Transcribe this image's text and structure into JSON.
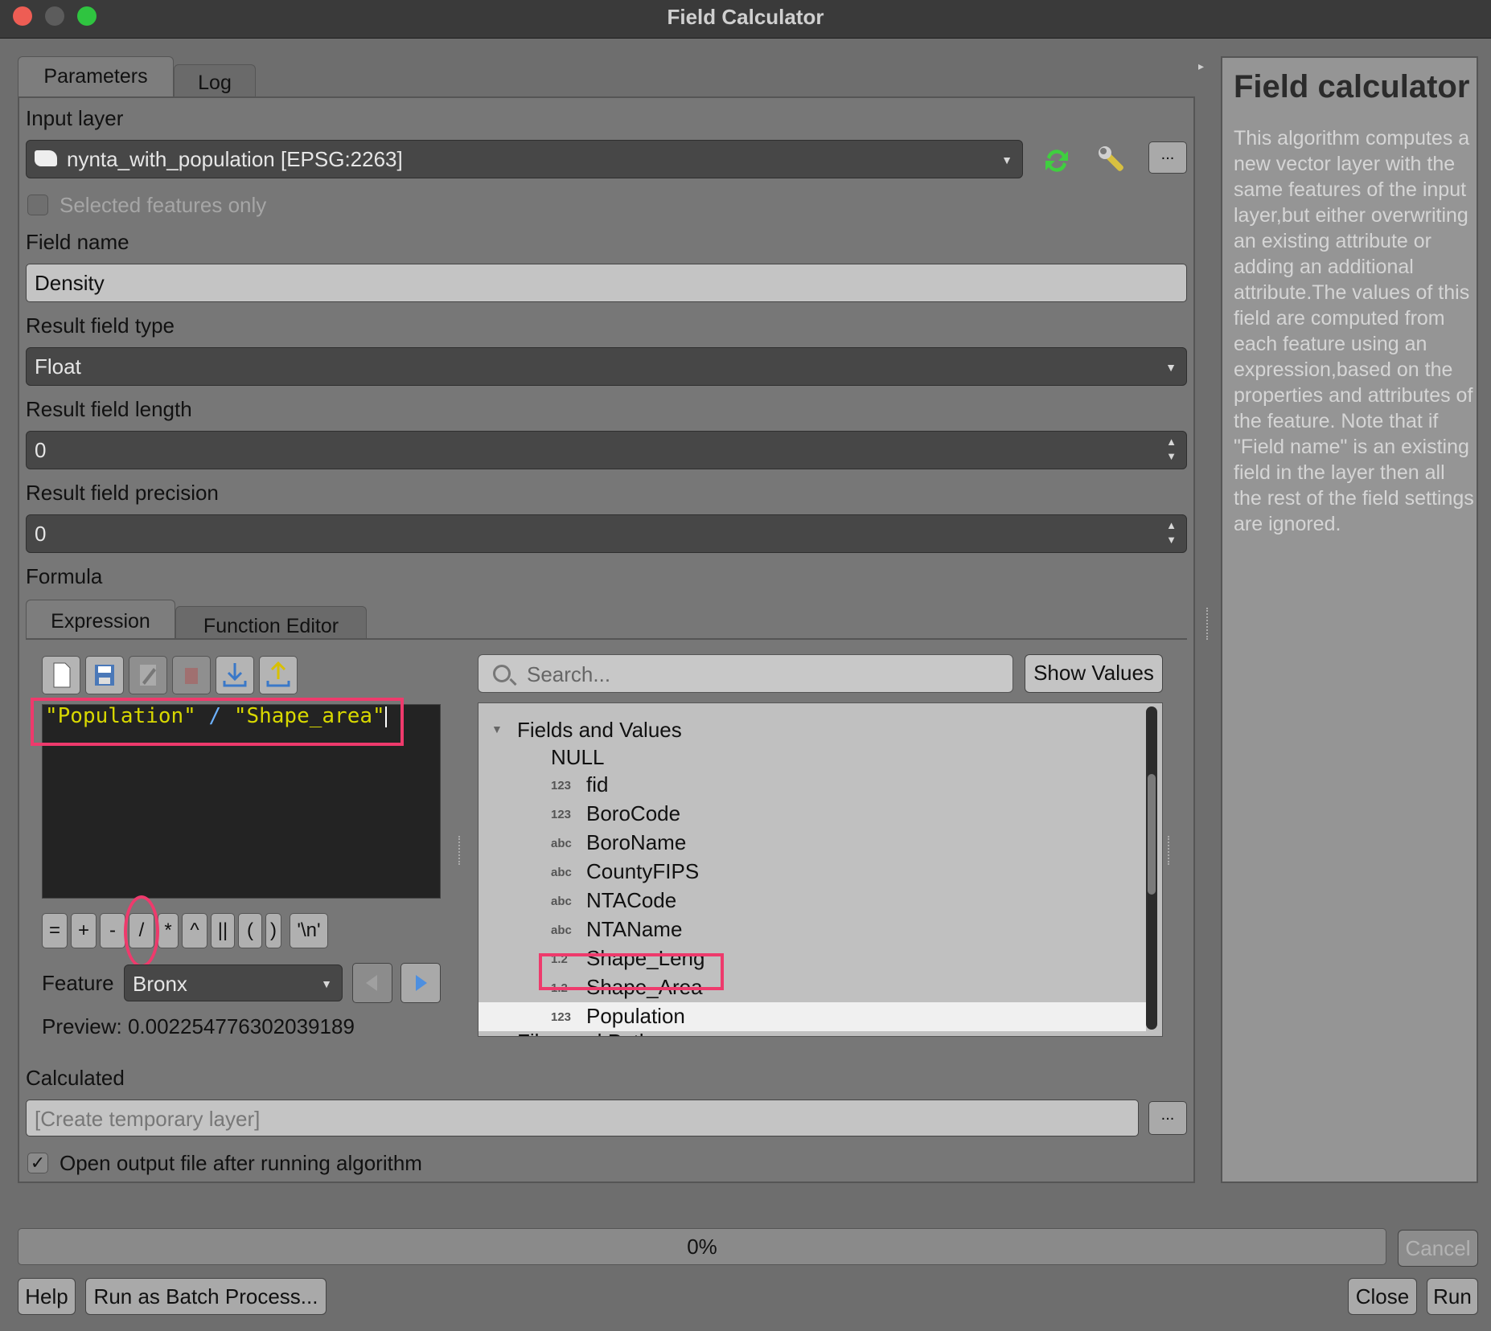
{
  "window": {
    "title": "Field Calculator"
  },
  "tabs": {
    "parameters": "Parameters",
    "log": "Log"
  },
  "input_layer": {
    "label": "Input layer",
    "value": "nynta_with_population [EPSG:2263]",
    "selected_only_label": "Selected features only"
  },
  "field_name": {
    "label": "Field name",
    "value": "Density"
  },
  "result_type": {
    "label": "Result field type",
    "value": "Float"
  },
  "result_length": {
    "label": "Result field length",
    "value": "0"
  },
  "result_precision": {
    "label": "Result field precision",
    "value": "0"
  },
  "formula": {
    "label": "Formula",
    "tab_expression": "Expression",
    "tab_function_editor": "Function Editor",
    "expr_left": "\"Population\"",
    "expr_op": "/",
    "expr_right": "\"Shape_area\"",
    "operators": [
      "=",
      "+",
      "-",
      "/",
      "*",
      "^",
      "||",
      "(",
      ")",
      "'\\n'"
    ],
    "feature_label": "Feature",
    "feature_value": "Bronx",
    "preview_label": "Preview:",
    "preview_value": "0.002254776302039189"
  },
  "search": {
    "placeholder": "Search...",
    "show_values": "Show Values"
  },
  "tree": {
    "group_fields": "Fields and Values",
    "null_item": "NULL",
    "items": [
      {
        "type": "123",
        "name": "fid"
      },
      {
        "type": "123",
        "name": "BoroCode"
      },
      {
        "type": "abc",
        "name": "BoroName"
      },
      {
        "type": "abc",
        "name": "CountyFIPS"
      },
      {
        "type": "abc",
        "name": "NTACode"
      },
      {
        "type": "abc",
        "name": "NTAName"
      },
      {
        "type": "1.2",
        "name": "Shape_Leng"
      },
      {
        "type": "1.2",
        "name": "Shape_Area"
      },
      {
        "type": "123",
        "name": "Population"
      }
    ],
    "group_files": "Files and Paths"
  },
  "output": {
    "label": "Calculated",
    "placeholder": "[Create temporary layer]",
    "open_after_label": "Open output file after running algorithm"
  },
  "help": {
    "title": "Field calculator",
    "body": "This algorithm computes a new vector layer with the same features of the input layer,but either overwriting an existing attribute or adding an additional attribute.The values of this field are computed from each feature using an expression,based on the properties and attributes of the feature. Note that if \"Field name\" is an existing field in the layer then all the rest of the field settings are ignored."
  },
  "progress": {
    "text": "0%"
  },
  "buttons": {
    "cancel": "Cancel",
    "help": "Help",
    "batch": "Run as Batch Process...",
    "close": "Close",
    "run": "Run",
    "ellipsis": "..."
  },
  "colors": {
    "highlight": "#ee3a6c",
    "expression_text": "#d8d800",
    "operator": "#6db2ff"
  }
}
